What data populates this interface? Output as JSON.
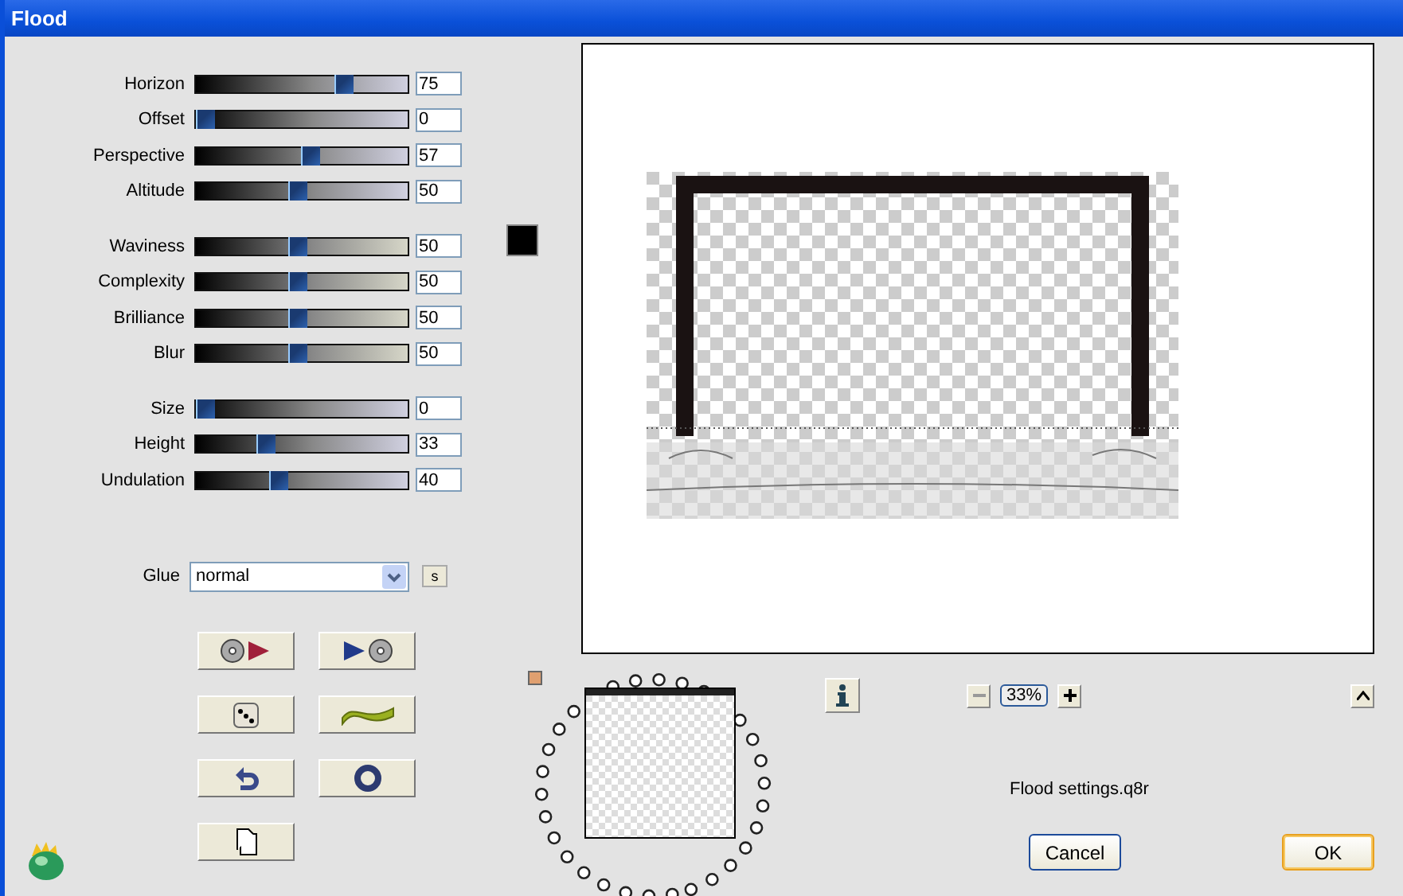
{
  "window": {
    "title": "Flood"
  },
  "slider_groups": [
    {
      "kind": "cool",
      "sliders": [
        {
          "label": "Horizon",
          "value": "75",
          "level": 0.75
        },
        {
          "label": "Offset",
          "value": "0",
          "level": 0
        },
        {
          "label": "Perspective",
          "value": "57",
          "level": 0.57
        },
        {
          "label": "Altitude",
          "value": "50",
          "level": 0.5
        }
      ]
    },
    {
      "kind": "warm",
      "sliders": [
        {
          "label": "Waviness",
          "value": "50",
          "level": 0.5
        },
        {
          "label": "Complexity",
          "value": "50",
          "level": 0.5
        },
        {
          "label": "Brilliance",
          "value": "50",
          "level": 0.5
        },
        {
          "label": "Blur",
          "value": "50",
          "level": 0.5
        }
      ]
    },
    {
      "kind": "cool",
      "sliders": [
        {
          "label": "Size",
          "value": "0",
          "level": 0
        },
        {
          "label": "Height",
          "value": "33",
          "level": 0.33
        },
        {
          "label": "Undulation",
          "value": "40",
          "level": 0.4
        }
      ]
    }
  ],
  "color_swatch": {
    "color": "#000000"
  },
  "glue": {
    "label": "Glue",
    "value": "normal",
    "side_button": "s"
  },
  "zoom": {
    "value": "33%"
  },
  "settings_file": "Flood settings.q8r",
  "buttons": [
    "Cancel",
    "OK"
  ]
}
